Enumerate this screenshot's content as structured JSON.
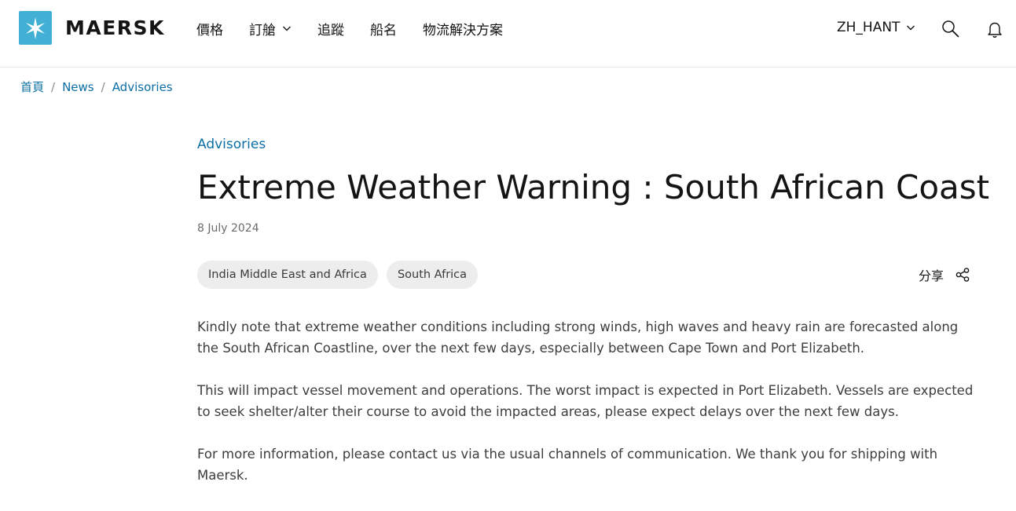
{
  "brand": {
    "name": "MAERSK",
    "color": "#42b0d5"
  },
  "nav": {
    "items": [
      {
        "label": "價格",
        "has_dropdown": false
      },
      {
        "label": "訂艙",
        "has_dropdown": true
      },
      {
        "label": "追蹤",
        "has_dropdown": false
      },
      {
        "label": "船名",
        "has_dropdown": false
      },
      {
        "label": "物流解決方案",
        "has_dropdown": false
      }
    ],
    "language": "ZH_HANT",
    "icons": [
      "search-icon",
      "bell-icon"
    ]
  },
  "breadcrumb": [
    "首頁",
    "News",
    "Advisories"
  ],
  "article": {
    "category": "Advisories",
    "title": "Extreme Weather Warning : South African Coast",
    "date": "8 July 2024",
    "tags": [
      "India Middle East and Africa",
      "South Africa"
    ],
    "share_label": "分享",
    "paragraphs": [
      "Kindly note that extreme weather conditions including strong winds, high waves and heavy rain are forecasted along the South African Coastline, over the next few days, especially between Cape Town and Port Elizabeth.",
      "This will impact vessel movement and operations. The worst impact is expected in Port Elizabeth. Vessels are expected to seek shelter/alter their course to avoid the impacted areas, please expect delays over the next few days.",
      "For more information, please contact us via the usual channels of communication. We thank you for shipping with Maersk."
    ]
  },
  "colors": {
    "link": "#0b6fa4",
    "tag_bg": "#ededed",
    "text": "#141414"
  }
}
